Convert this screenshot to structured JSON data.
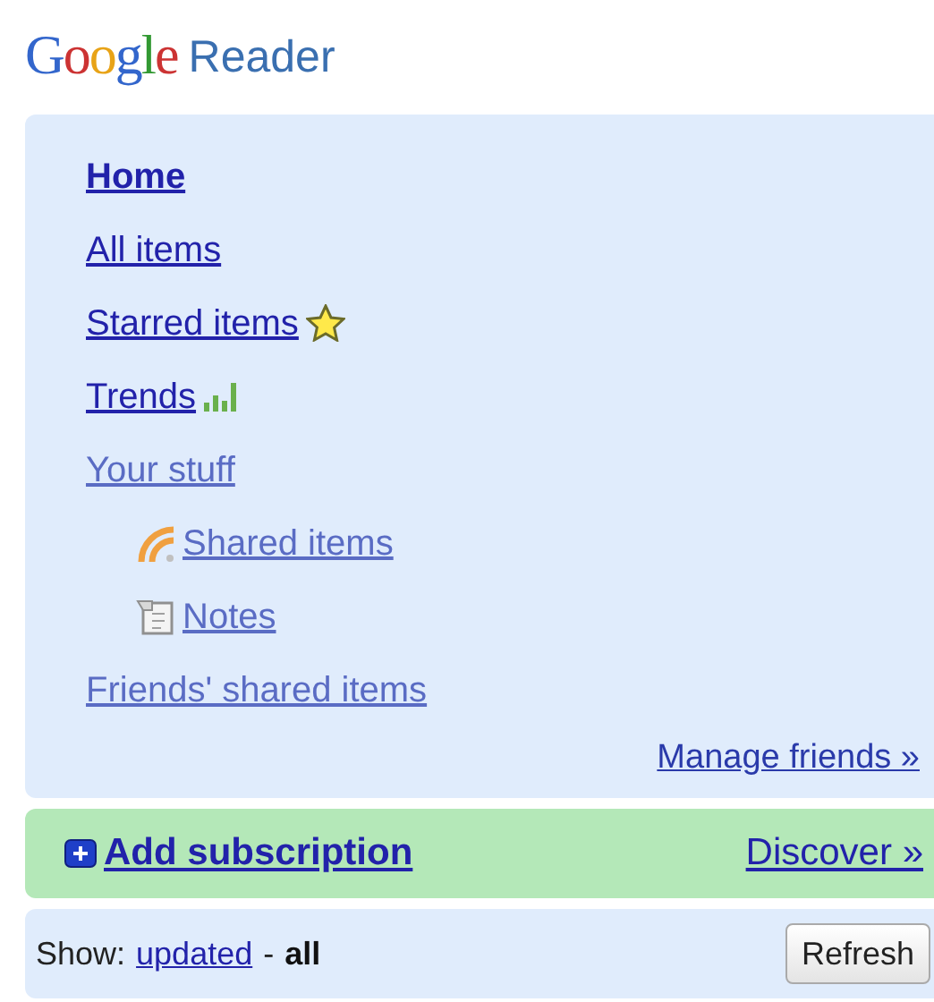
{
  "logo": {
    "brand": "Google",
    "product": "Reader"
  },
  "nav": {
    "items": [
      {
        "label": "Home",
        "kind": "view",
        "selected": true
      },
      {
        "label": "All items",
        "kind": "view",
        "selected": false
      },
      {
        "label": "Starred items",
        "kind": "starred",
        "selected": false
      },
      {
        "label": "Trends",
        "kind": "trends",
        "selected": false
      },
      {
        "label": "Your stuff",
        "kind": "section",
        "selected": false,
        "children": [
          {
            "label": "Shared items",
            "kind": "shared",
            "selected": false
          },
          {
            "label": "Notes",
            "kind": "notes",
            "selected": false
          }
        ]
      },
      {
        "label": "Friends' shared items",
        "kind": "section",
        "selected": false
      }
    ],
    "manage_link": "Manage friends »"
  },
  "subscribe_bar": {
    "add_link": "Add subscription",
    "discover_link": "Discover »"
  },
  "filter": {
    "label": "Show:",
    "separator": "-",
    "options": [
      {
        "label": "updated",
        "selected": false
      },
      {
        "label": "all",
        "selected": true
      }
    ],
    "refresh_button": "Refresh"
  }
}
